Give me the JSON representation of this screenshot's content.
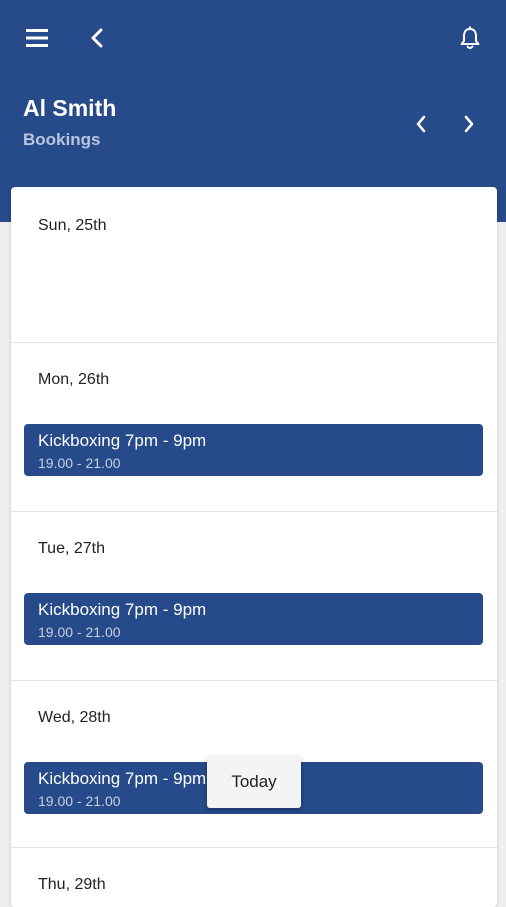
{
  "header": {
    "title": "Al Smith",
    "subtitle": "Bookings",
    "color": "#264a8a",
    "icons": {
      "menu": "menu-icon",
      "back": "chevron-left-icon",
      "notifications": "bell-icon",
      "prev": "chevron-left-icon",
      "next": "chevron-right-icon"
    }
  },
  "days": [
    {
      "label": "Sun, 25th",
      "events": []
    },
    {
      "label": "Mon, 26th",
      "events": [
        {
          "title": "Kickboxing 7pm - 9pm",
          "time": "19.00 - 21.00"
        }
      ]
    },
    {
      "label": "Tue, 27th",
      "events": [
        {
          "title": "Kickboxing 7pm - 9pm",
          "time": "19.00 - 21.00"
        }
      ]
    },
    {
      "label": "Wed, 28th",
      "events": [
        {
          "title": "Kickboxing 7pm - 9pm",
          "time": "19.00 - 21.00"
        }
      ]
    },
    {
      "label": "Thu, 29th",
      "events": []
    }
  ],
  "today_button": "Today"
}
